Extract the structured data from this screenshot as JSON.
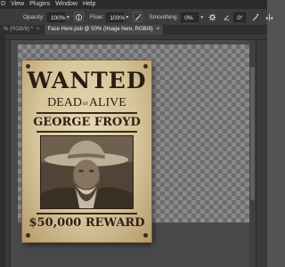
{
  "menubar": {
    "items": [
      "D",
      "View",
      "Plugins",
      "Window",
      "Help"
    ]
  },
  "options_bar": {
    "opacity_label": "Opacity:",
    "opacity_value": "100%",
    "flow_label": "Flow:",
    "flow_value": "100%",
    "smoothing_label": "Smoothing:",
    "smoothing_value": "0%",
    "angle_value": "0°"
  },
  "tabs": [
    {
      "label": "% (RGB/8) *",
      "active": false
    },
    {
      "label": "Face Here.psb @ 50% (Image here, RGB/8)",
      "active": true
    }
  ],
  "poster": {
    "headline": "WANTED",
    "dead": "DEAD",
    "or": "or",
    "alive": "ALIVE",
    "name": "GEORGE FROYD",
    "reward": "$50,000 REWARD"
  },
  "colors": {
    "accent_paper": "#d6c59b",
    "ink": "#2e2116",
    "ui_dark": "#2b2b2b"
  }
}
